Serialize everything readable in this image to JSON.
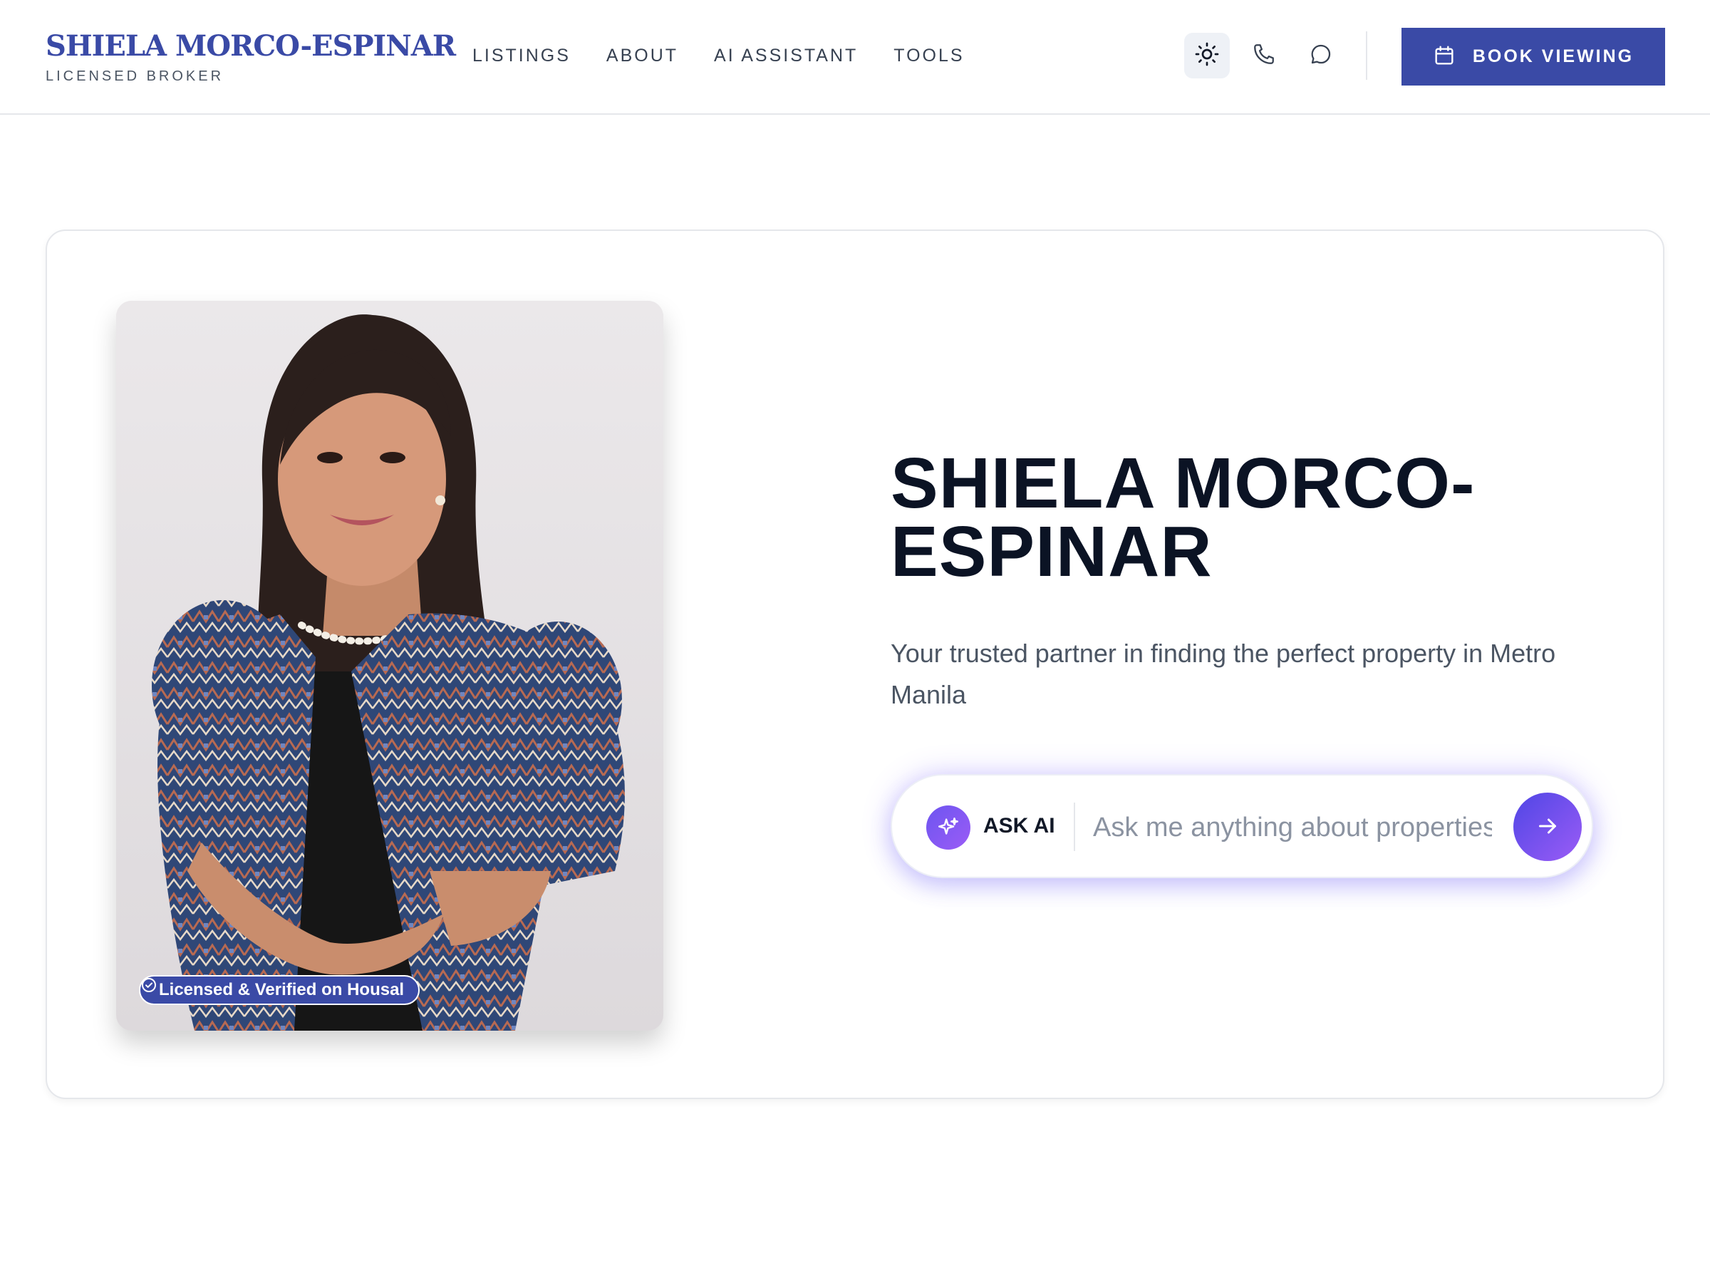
{
  "brand": {
    "name": "SHIELA MORCO-ESPINAR",
    "subtitle": "LICENSED BROKER"
  },
  "nav": {
    "items": [
      {
        "label": "LISTINGS"
      },
      {
        "label": "ABOUT"
      },
      {
        "label": "AI ASSISTANT"
      },
      {
        "label": "TOOLS"
      }
    ]
  },
  "header_actions": {
    "theme_icon": "sun-icon",
    "phone_icon": "phone-icon",
    "chat_icon": "chat-bubble-icon",
    "book_icon": "calendar-icon",
    "book_label": "BOOK VIEWING"
  },
  "hero": {
    "title": "SHIELA MORCO-ESPINAR",
    "subtitle": "Your trusted partner in finding the perfect property in Metro Manila",
    "badge_icon": "check-circle-icon",
    "badge_label": "Licensed & Verified on Housal"
  },
  "ask_ai": {
    "icon": "sparkle-icon",
    "label": "ASK AI",
    "placeholder": "Ask me anything about properties...",
    "value": "",
    "send_icon": "arrow-right-icon"
  },
  "colors": {
    "brand": "#3a4aa6",
    "title": "#0b1324",
    "muted": "#4b5563",
    "ai_gradient_start": "#4f46e5",
    "ai_gradient_end": "#9b5cf6"
  }
}
